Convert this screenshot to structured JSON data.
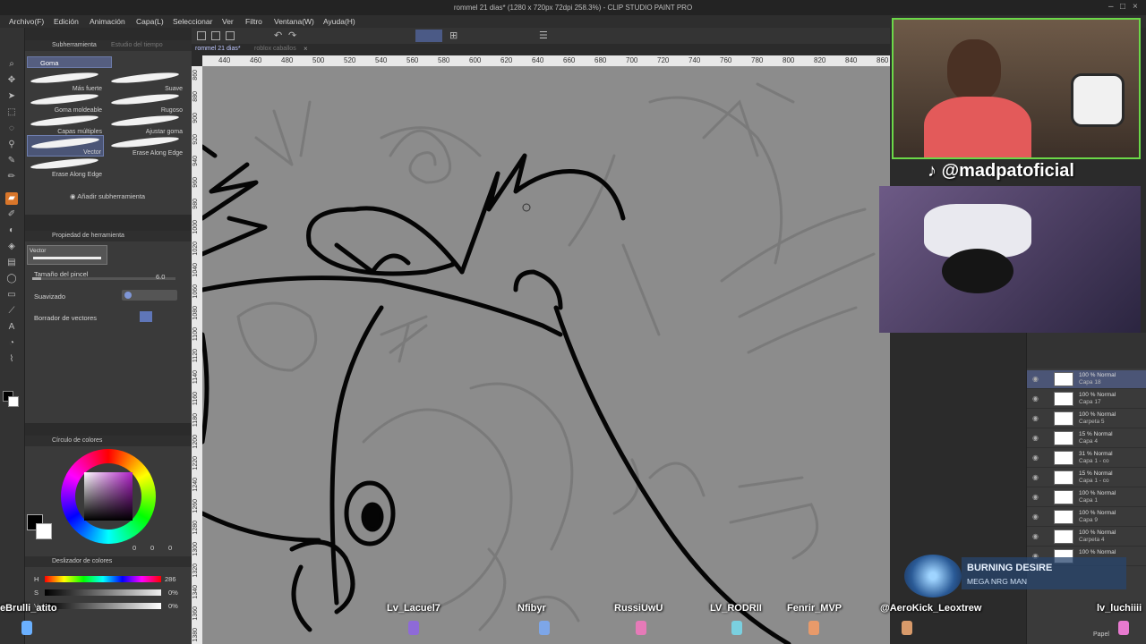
{
  "window": {
    "title": "rommel 21 dias* (1280 x 720px 72dpi 258.3%) - CLIP STUDIO PAINT PRO",
    "controls": [
      "–",
      "□",
      "×"
    ]
  },
  "menu": [
    "Archivo(F)",
    "Edición",
    "Animación",
    "Capa(L)",
    "Seleccionar",
    "Ver",
    "Filtro",
    "Ventana(W)",
    "Ayuda(H)"
  ],
  "subtool_panel": {
    "tabs": [
      "Subherramienta",
      "Estudio del tiempo"
    ],
    "group": "Goma",
    "brushes": [
      {
        "label": "Más fuerte"
      },
      {
        "label": "Suave"
      },
      {
        "label": "Goma moldeable"
      },
      {
        "label": "Rugoso"
      },
      {
        "label": "Capas múltiples"
      },
      {
        "label": "Ajustar goma"
      },
      {
        "label": "Vector"
      },
      {
        "label": "Erase Along Edge"
      },
      {
        "label": "Erase Along Edge"
      }
    ],
    "add_label": "Añadir subherramienta"
  },
  "tool_property": {
    "tab": "Propiedad de herramienta",
    "preset": "Vector",
    "brush_size_label": "Tamaño del pincel",
    "brush_size_value": "6.0",
    "smoothing_label": "Suavizado",
    "vector_eraser_label": "Borrador de vectores"
  },
  "color_panel": {
    "title": "Círculo de colores",
    "values": [
      "0",
      "0",
      "0"
    ],
    "main_color": "#000000",
    "sub_color": "#ffffff"
  },
  "slider_panel": {
    "title": "Deslizador de colores",
    "h_label": "H",
    "h_value": "286",
    "s_label": "S",
    "s_value": "0%",
    "v_label": "V",
    "v_value": "0%"
  },
  "doc_tabs": [
    "rommel 21 dias*",
    "roblox caballos"
  ],
  "ruler_top": [
    "440",
    "460",
    "480",
    "500",
    "520",
    "540",
    "560",
    "580",
    "600",
    "620",
    "640",
    "660",
    "680",
    "700",
    "720",
    "740",
    "760",
    "780",
    "800",
    "820",
    "840",
    "860"
  ],
  "ruler_left": [
    "860",
    "880",
    "900",
    "920",
    "940",
    "960",
    "980",
    "1000",
    "1020",
    "1040",
    "1060",
    "1080",
    "1100",
    "1120",
    "1140",
    "1160",
    "1180",
    "1200",
    "1220",
    "1240",
    "1260",
    "1280",
    "1300",
    "1320",
    "1340",
    "1360",
    "1380"
  ],
  "stream": {
    "handle": "@madpatoficial",
    "now_playing_title": "BURNING DESIRE",
    "now_playing_artist": "MEGA NRG MAN",
    "viewers": [
      "eBrulli_atito",
      "Lv_Lacuel7",
      "Nfibyr",
      "RussiUwU",
      "LV_RODRII",
      "Fenrir_MVP",
      "@AeroKick_Leoxtrew",
      "lv_luchiiii"
    ]
  },
  "layers": [
    {
      "mode": "100 % Normal",
      "name": "Capa 18"
    },
    {
      "mode": "100 % Normal",
      "name": "Capa 17"
    },
    {
      "mode": "100 % Normal",
      "name": "Carpeta 5"
    },
    {
      "mode": "15 % Normal",
      "name": "Capa 4"
    },
    {
      "mode": "31 % Normal",
      "name": "Capa 1 - co"
    },
    {
      "mode": "15 % Normal",
      "name": "Capa 1 - co"
    },
    {
      "mode": "100 % Normal",
      "name": "Capa 1"
    },
    {
      "mode": "100 % Normal",
      "name": "Capa 9"
    },
    {
      "mode": "100 % Normal",
      "name": "Carpeta 4"
    },
    {
      "mode": "100 % Normal",
      "name": ""
    }
  ],
  "bottom_label": "Papel",
  "colors": {
    "cam_border": "#6bd848",
    "selection": "#4b5576",
    "canvas": "#8c8c8c"
  }
}
